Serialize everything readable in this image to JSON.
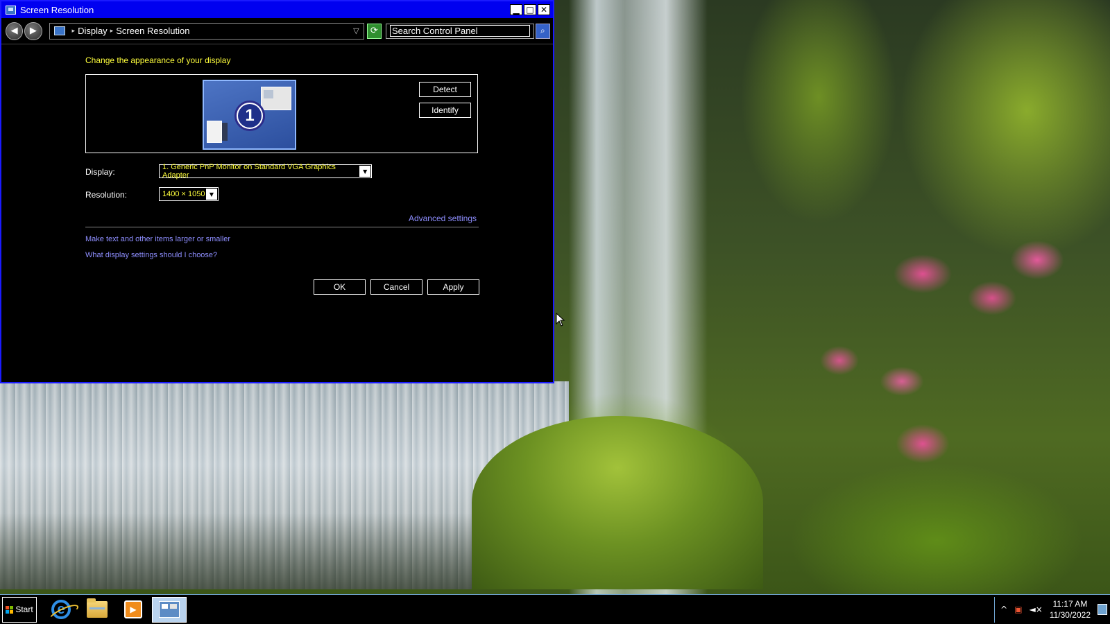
{
  "window": {
    "title": "Screen Resolution",
    "controls": {
      "minimize": "▁",
      "maximize": "□",
      "close": "✕"
    }
  },
  "navigation": {
    "back_icon": "◀",
    "forward_icon": "▶",
    "breadcrumb": [
      "Display",
      "Screen Resolution"
    ],
    "separator": "▸",
    "dropdown_icon": "▽",
    "refresh_icon": "⟳",
    "search_placeholder": "Search Control Panel",
    "search_icon": "⌕"
  },
  "content": {
    "heading": "Change the appearance of your display",
    "monitor_number": "1",
    "detect_label": "Detect",
    "identify_label": "Identify",
    "display_label": "Display:",
    "display_value": "1. Generic PnP Monitor on Standard VGA Graphics Adapter",
    "resolution_label": "Resolution:",
    "resolution_value": "1400 × 1050",
    "select_arrow": "▼",
    "advanced_link": "Advanced settings",
    "help_links": [
      "Make text and other items larger or smaller",
      "What display settings should I choose?"
    ],
    "ok_label": "OK",
    "cancel_label": "Cancel",
    "apply_label": "Apply"
  },
  "taskbar": {
    "start_label": "Start",
    "apps": [
      "internet-explorer",
      "file-explorer",
      "media-player",
      "control-panel"
    ],
    "media_glyph": "▶",
    "ie_glyph": "e",
    "tray": {
      "chevron": "^",
      "network_icon": "▣",
      "volume_icon": "◄×",
      "time": "11:17 AM",
      "date": "11/30/2022"
    }
  },
  "colors": {
    "titlebar": "#0000f0",
    "heading": "#ffff3c",
    "link": "#8e8eff",
    "window_bg": "#000000"
  }
}
